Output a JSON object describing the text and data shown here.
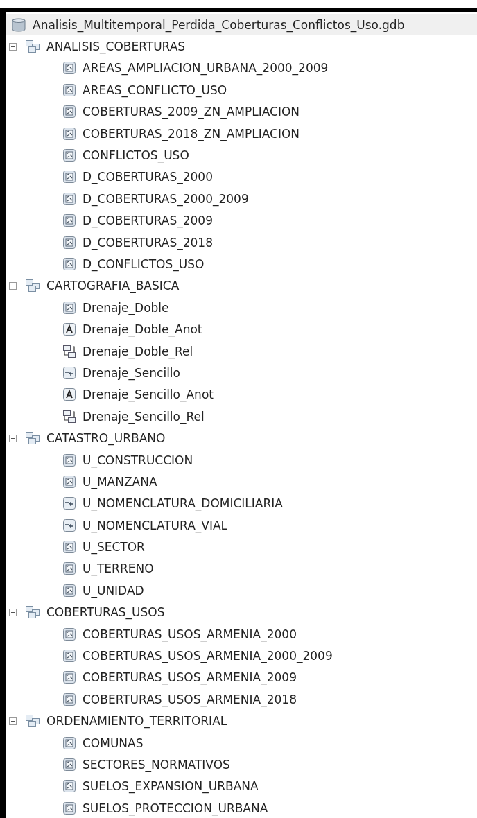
{
  "root": {
    "name": "Analisis_Multitemporal_Perdida_Coberturas_Conflictos_Uso.gdb"
  },
  "datasets": [
    {
      "name": "ANALISIS_COBERTURAS",
      "expanded": true,
      "children": [
        {
          "name": "AREAS_AMPLIACION_URBANA_2000_2009",
          "kind": "polygon"
        },
        {
          "name": "AREAS_CONFLICTO_USO",
          "kind": "polygon"
        },
        {
          "name": "COBERTURAS_2009_ZN_AMPLIACION",
          "kind": "polygon"
        },
        {
          "name": "COBERTURAS_2018_ZN_AMPLIACION",
          "kind": "polygon"
        },
        {
          "name": "CONFLICTOS_USO",
          "kind": "polygon"
        },
        {
          "name": "D_COBERTURAS_2000",
          "kind": "polygon"
        },
        {
          "name": "D_COBERTURAS_2000_2009",
          "kind": "polygon"
        },
        {
          "name": "D_COBERTURAS_2009",
          "kind": "polygon"
        },
        {
          "name": "D_COBERTURAS_2018",
          "kind": "polygon"
        },
        {
          "name": "D_CONFLICTOS_USO",
          "kind": "polygon"
        }
      ]
    },
    {
      "name": "CARTOGRAFIA_BASICA",
      "expanded": true,
      "children": [
        {
          "name": "Drenaje_Doble",
          "kind": "polygon"
        },
        {
          "name": "Drenaje_Doble_Anot",
          "kind": "annotation"
        },
        {
          "name": "Drenaje_Doble_Rel",
          "kind": "relationship"
        },
        {
          "name": "Drenaje_Sencillo",
          "kind": "line"
        },
        {
          "name": "Drenaje_Sencillo_Anot",
          "kind": "annotation"
        },
        {
          "name": "Drenaje_Sencillo_Rel",
          "kind": "relationship"
        }
      ]
    },
    {
      "name": "CATASTRO_URBANO",
      "expanded": true,
      "children": [
        {
          "name": "U_CONSTRUCCION",
          "kind": "polygon"
        },
        {
          "name": "U_MANZANA",
          "kind": "polygon"
        },
        {
          "name": "U_NOMENCLATURA_DOMICILIARIA",
          "kind": "line"
        },
        {
          "name": "U_NOMENCLATURA_VIAL",
          "kind": "line"
        },
        {
          "name": "U_SECTOR",
          "kind": "polygon"
        },
        {
          "name": "U_TERRENO",
          "kind": "polygon"
        },
        {
          "name": "U_UNIDAD",
          "kind": "polygon"
        }
      ]
    },
    {
      "name": "COBERTURAS_USOS",
      "expanded": true,
      "children": [
        {
          "name": "COBERTURAS_USOS_ARMENIA_2000",
          "kind": "polygon"
        },
        {
          "name": "COBERTURAS_USOS_ARMENIA_2000_2009",
          "kind": "polygon"
        },
        {
          "name": "COBERTURAS_USOS_ARMENIA_2009",
          "kind": "polygon"
        },
        {
          "name": "COBERTURAS_USOS_ARMENIA_2018",
          "kind": "polygon"
        }
      ]
    },
    {
      "name": "ORDENAMIENTO_TERRITORIAL",
      "expanded": true,
      "children": [
        {
          "name": "COMUNAS",
          "kind": "polygon"
        },
        {
          "name": "SECTORES_NORMATIVOS",
          "kind": "polygon"
        },
        {
          "name": "SUELOS_EXPANSION_URBANA",
          "kind": "polygon"
        },
        {
          "name": "SUELOS_PROTECCION_URBANA",
          "kind": "polygon"
        }
      ]
    }
  ]
}
